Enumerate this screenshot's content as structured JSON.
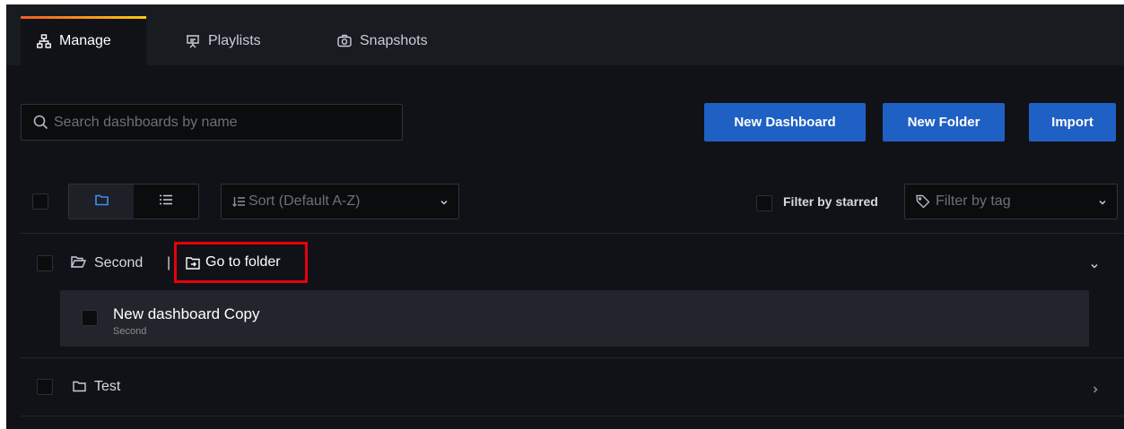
{
  "tabs": [
    {
      "label": "Manage",
      "icon": "sitemap-icon",
      "active": true
    },
    {
      "label": "Playlists",
      "icon": "presentation-icon",
      "active": false
    },
    {
      "label": "Snapshots",
      "icon": "camera-icon",
      "active": false
    }
  ],
  "search": {
    "placeholder": "Search dashboards by name",
    "value": ""
  },
  "actions": {
    "new_dashboard": "New Dashboard",
    "new_folder": "New Folder",
    "import": "Import"
  },
  "toolbar": {
    "sort_label": "Sort (Default A-Z)",
    "filter_starred_label": "Filter by starred",
    "filter_tag_placeholder": "Filter by tag"
  },
  "folders": [
    {
      "name": "Second",
      "separator": "|",
      "goto_label": "Go to folder",
      "expanded": true,
      "dashboards": [
        {
          "title": "New dashboard Copy",
          "folder": "Second"
        }
      ]
    },
    {
      "name": "Test",
      "expanded": false
    }
  ],
  "colors": {
    "primary_button": "#1f60c4",
    "highlight_border": "#e8000b",
    "background": "#111217"
  }
}
